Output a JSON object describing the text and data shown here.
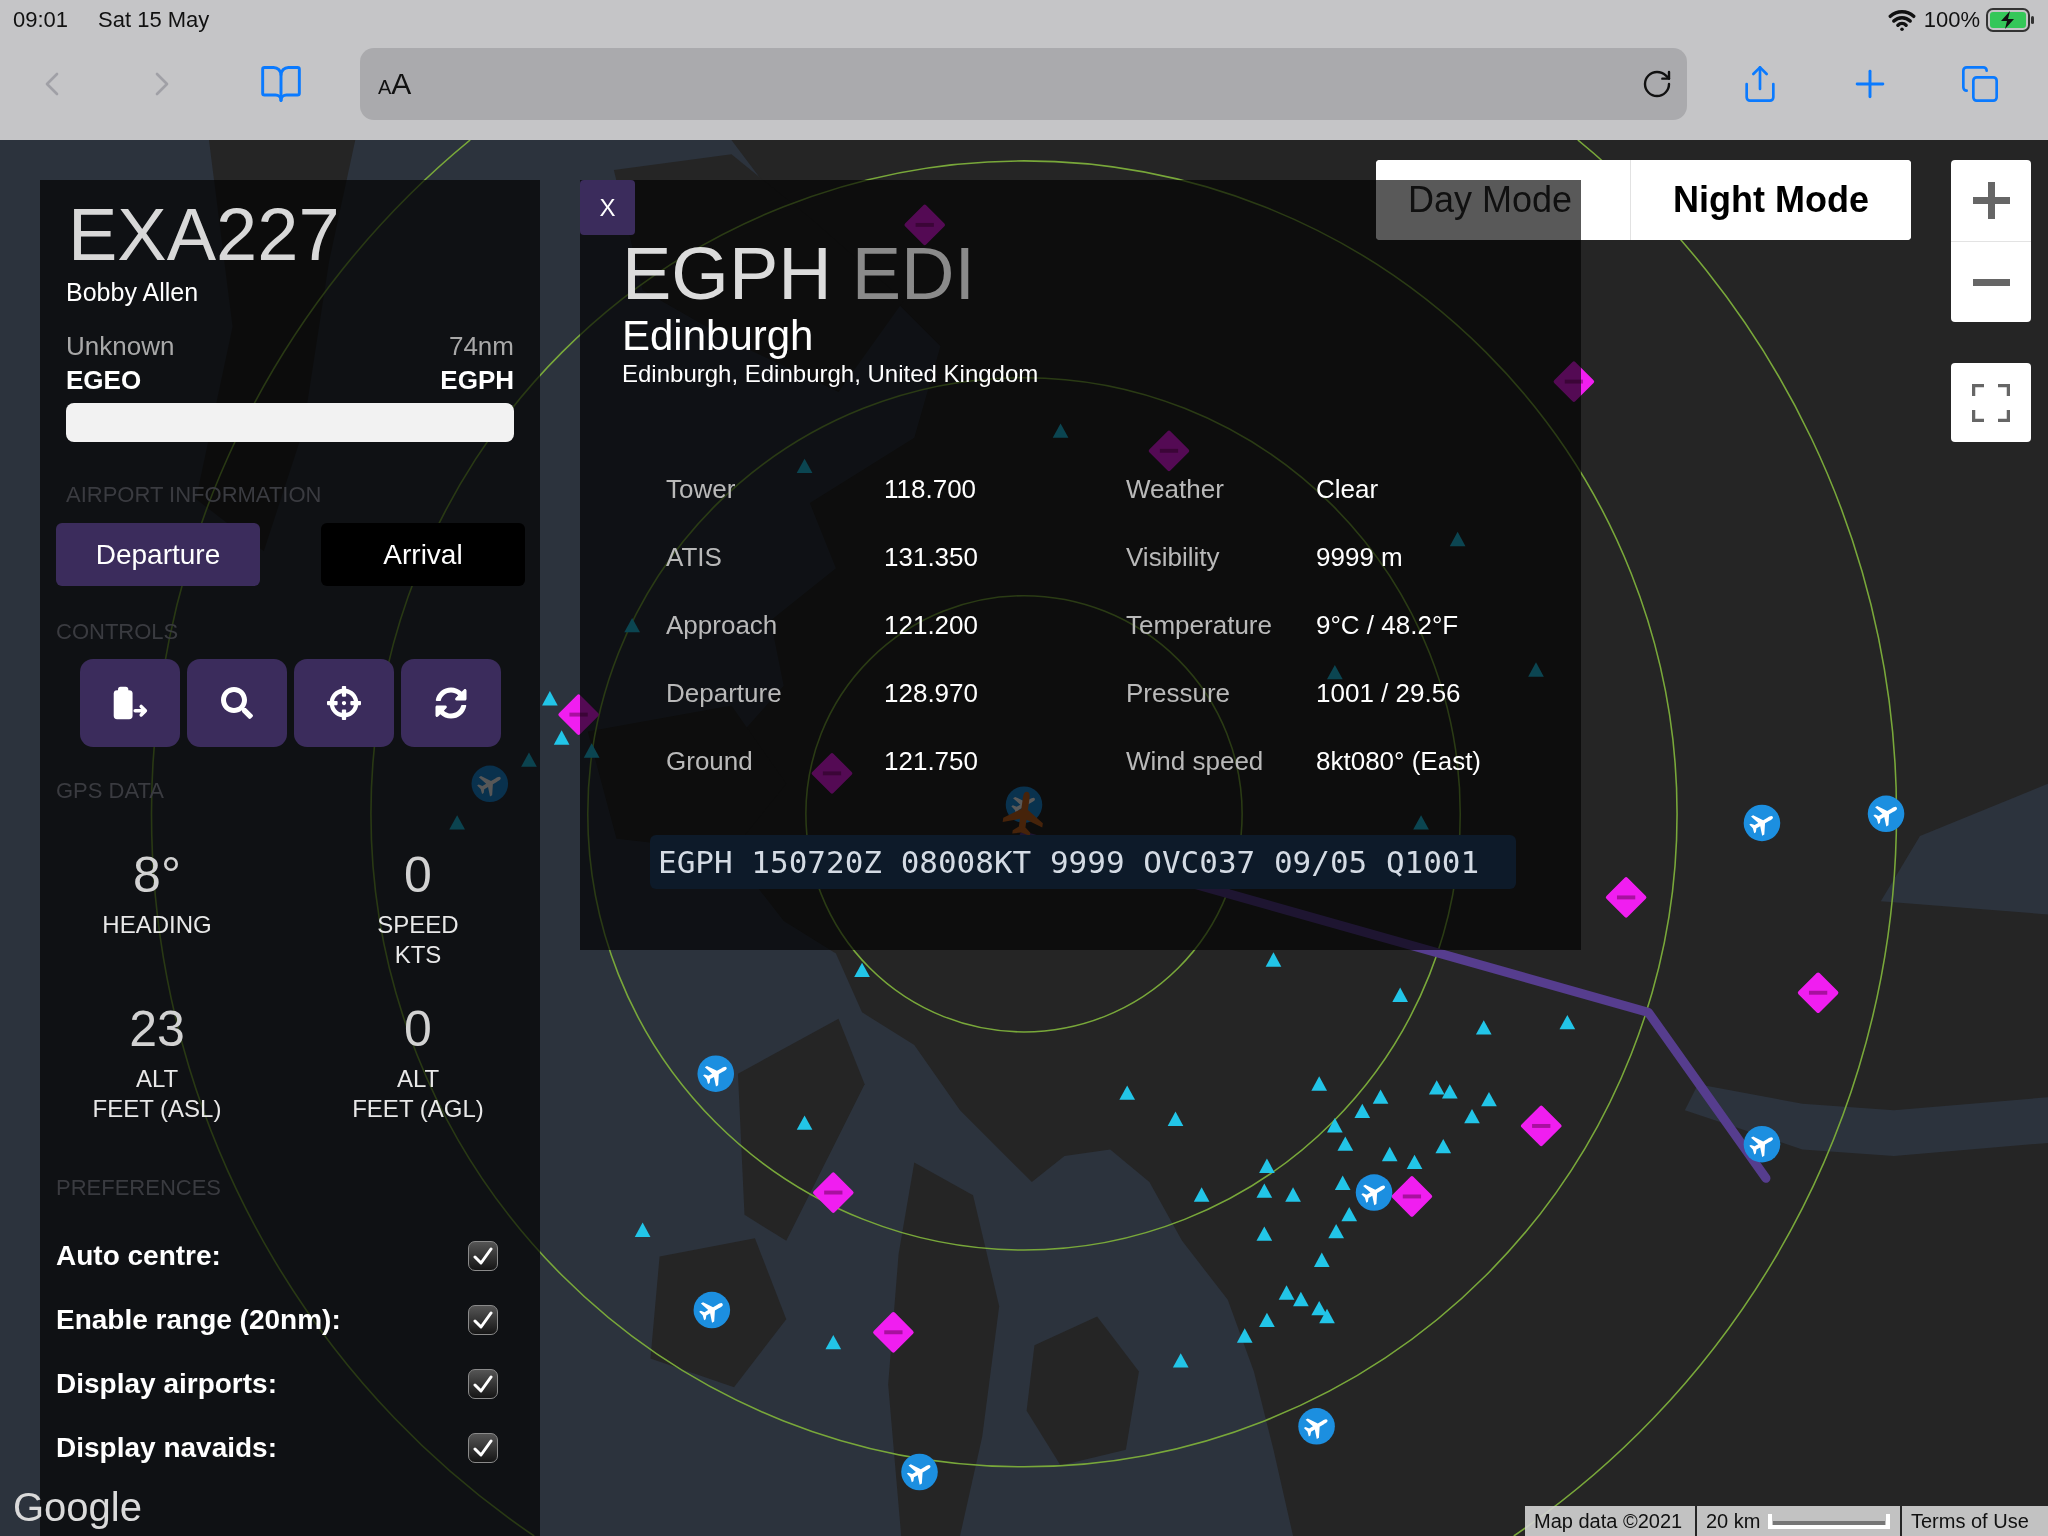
{
  "status_bar": {
    "time": "09:01",
    "date": "Sat 15 May",
    "battery": "100%",
    "charging": true
  },
  "browser_toolbar": {
    "back": {
      "disabled": true
    },
    "forward": {
      "disabled": true
    },
    "reader_button": {
      "small": "A",
      "large": "A"
    }
  },
  "flight_panel": {
    "callsign": "EXA227",
    "pilot": "Bobby Allen",
    "status": "Unknown",
    "distance": "74nm",
    "origin": "EGEO",
    "destination": "EGPH",
    "progress": {
      "level": 0
    },
    "airport_info_heading": "AIRPORT INFORMATION",
    "airport_tabs": [
      {
        "label": "Departure",
        "selected": true
      },
      {
        "label": "Arrival",
        "selected": false
      }
    ],
    "controls_heading": "CONTROLS",
    "controls": [
      {
        "kind": "clipboard"
      },
      {
        "kind": "search"
      },
      {
        "kind": "crosshair"
      },
      {
        "kind": "refresh"
      }
    ],
    "gps_heading": "GPS DATA",
    "gps_data": [
      {
        "value": "8°",
        "label": "HEADING"
      },
      {
        "value": "0",
        "label": "SPEED",
        "unit": "KTS"
      },
      {
        "value": "23",
        "label": "ALT",
        "unit": "FEET (ASL)"
      },
      {
        "value": "0",
        "label": "ALT",
        "unit": "FEET (AGL)"
      }
    ],
    "preferences_heading": "PREFERENCES",
    "preferences": [
      {
        "label": "Auto centre:",
        "checked": true
      },
      {
        "label": "Enable range (20nm):",
        "checked": true
      },
      {
        "label": "Display airports:",
        "checked": true
      },
      {
        "label": "Display navaids:",
        "checked": true
      }
    ]
  },
  "airport_popup": {
    "close": "X",
    "icao": "EGPH",
    "iata": "EDI",
    "name": "Edinburgh",
    "location": "Edinburgh, Edinburgh, United Kingdom",
    "frequencies": [
      {
        "label": "Tower",
        "value": "118.700"
      },
      {
        "label": "ATIS",
        "value": "131.350"
      },
      {
        "label": "Approach",
        "value": "121.200"
      },
      {
        "label": "Departure",
        "value": "128.970"
      },
      {
        "label": "Ground",
        "value": "121.750"
      }
    ],
    "conditions": [
      {
        "label": "Weather",
        "value": "Clear"
      },
      {
        "label": "Visibility",
        "value": "9999 m"
      },
      {
        "label": "Temperature",
        "value": "9°C / 48.2°F"
      },
      {
        "label": "Pressure",
        "value": "1001 / 29.56"
      },
      {
        "label": "Wind speed",
        "value": "8kt080° (East)"
      }
    ],
    "metar": "EGPH 150720Z 08008KT 9999 OVC037 09/05 Q1001"
  },
  "map_mode": [
    {
      "label": "Day Mode",
      "selected": false
    },
    {
      "label": "Night Mode",
      "selected": true
    }
  ],
  "map_attribution": {
    "logo": "Google",
    "data": "Map data ©2021",
    "scale": "20 km",
    "terms": "Terms of Use"
  }
}
